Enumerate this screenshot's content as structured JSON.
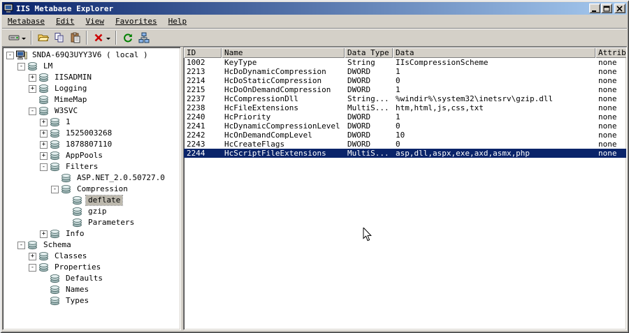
{
  "window": {
    "title": "IIS Metabase Explorer",
    "controls": [
      "minimize",
      "maximize",
      "close"
    ]
  },
  "menu": {
    "items": [
      "Metabase",
      "Edit",
      "View",
      "Favorites",
      "Help"
    ]
  },
  "toolbar": {
    "buttons": [
      {
        "name": "connect-button",
        "icon": "drive-connect-icon",
        "dropdown": true,
        "sep_before": false
      },
      {
        "name": "open-button",
        "icon": "folder-open-icon",
        "dropdown": false,
        "sep_before": true
      },
      {
        "name": "copy-button",
        "icon": "copy-icon",
        "dropdown": false,
        "sep_before": false
      },
      {
        "name": "paste-button",
        "icon": "paste-icon",
        "dropdown": false,
        "sep_before": false
      },
      {
        "name": "delete-button",
        "icon": "delete-x-icon",
        "dropdown": true,
        "sep_before": true
      },
      {
        "name": "refresh-button",
        "icon": "refresh-icon",
        "dropdown": false,
        "sep_before": true
      },
      {
        "name": "network-button",
        "icon": "network-nodes-icon",
        "dropdown": false,
        "sep_before": false
      }
    ]
  },
  "tree": {
    "items": [
      {
        "level": 0,
        "label": "SNDA-69Q3UYY3V6 ( local )",
        "expand": "-",
        "icon": "computer",
        "selected": false
      },
      {
        "level": 1,
        "label": "LM",
        "expand": "-",
        "icon": "key",
        "selected": false
      },
      {
        "level": 2,
        "label": "IISADMIN",
        "expand": "+",
        "icon": "key",
        "selected": false
      },
      {
        "level": 2,
        "label": "Logging",
        "expand": "+",
        "icon": "key",
        "selected": false
      },
      {
        "level": 2,
        "label": "MimeMap",
        "expand": "",
        "icon": "key",
        "selected": false
      },
      {
        "level": 2,
        "label": "W3SVC",
        "expand": "-",
        "icon": "key",
        "selected": false
      },
      {
        "level": 3,
        "label": "1",
        "expand": "+",
        "icon": "key",
        "selected": false
      },
      {
        "level": 3,
        "label": "1525003268",
        "expand": "+",
        "icon": "key",
        "selected": false
      },
      {
        "level": 3,
        "label": "1878807110",
        "expand": "+",
        "icon": "key",
        "selected": false
      },
      {
        "level": 3,
        "label": "AppPools",
        "expand": "+",
        "icon": "key",
        "selected": false
      },
      {
        "level": 3,
        "label": "Filters",
        "expand": "-",
        "icon": "key",
        "selected": false
      },
      {
        "level": 4,
        "label": "ASP.NET_2.0.50727.0",
        "expand": "",
        "icon": "key",
        "selected": false
      },
      {
        "level": 4,
        "label": "Compression",
        "expand": "-",
        "icon": "key",
        "selected": false
      },
      {
        "level": 5,
        "label": "deflate",
        "expand": "",
        "icon": "key",
        "selected": true
      },
      {
        "level": 5,
        "label": "gzip",
        "expand": "",
        "icon": "key",
        "selected": false
      },
      {
        "level": 5,
        "label": "Parameters",
        "expand": "",
        "icon": "key",
        "selected": false
      },
      {
        "level": 3,
        "label": "Info",
        "expand": "+",
        "icon": "key",
        "selected": false
      },
      {
        "level": 1,
        "label": "Schema",
        "expand": "-",
        "icon": "key",
        "selected": false
      },
      {
        "level": 2,
        "label": "Classes",
        "expand": "+",
        "icon": "key",
        "selected": false
      },
      {
        "level": 2,
        "label": "Properties",
        "expand": "-",
        "icon": "key",
        "selected": false
      },
      {
        "level": 3,
        "label": "Defaults",
        "expand": "",
        "icon": "key",
        "selected": false
      },
      {
        "level": 3,
        "label": "Names",
        "expand": "",
        "icon": "key",
        "selected": false
      },
      {
        "level": 3,
        "label": "Types",
        "expand": "",
        "icon": "key",
        "selected": false
      }
    ]
  },
  "list": {
    "columns": [
      "ID",
      "Name",
      "Data Type",
      "Data",
      "Attributes"
    ],
    "rows": [
      [
        "1002",
        "KeyType",
        "String",
        "IIsCompressionScheme",
        "none"
      ],
      [
        "2213",
        "HcDoDynamicCompression",
        "DWORD",
        "1",
        "none"
      ],
      [
        "2214",
        "HcDoStaticCompression",
        "DWORD",
        "0",
        "none"
      ],
      [
        "2215",
        "HcDoOnDemandCompression",
        "DWORD",
        "1",
        "none"
      ],
      [
        "2237",
        "HcCompressionDll",
        "String...",
        "%windir%\\system32\\inetsrv\\gzip.dll",
        "none"
      ],
      [
        "2238",
        "HcFileExtensions",
        "MultiS...",
        "htm,html,js,css,txt",
        "none"
      ],
      [
        "2240",
        "HcPriority",
        "DWORD",
        "1",
        "none"
      ],
      [
        "2241",
        "HcDynamicCompressionLevel",
        "DWORD",
        "0",
        "none"
      ],
      [
        "2242",
        "HcOnDemandCompLevel",
        "DWORD",
        "10",
        "none"
      ],
      [
        "2243",
        "HcCreateFlags",
        "DWORD",
        "0",
        "none"
      ],
      [
        "2244",
        "HcScriptFileExtensions",
        "MultiS...",
        "asp,dll,aspx,exe,axd,asmx,php",
        "none"
      ]
    ],
    "selected_row_index": 10
  },
  "colors": {
    "titlebar-left": "#0a246a",
    "titlebar-right": "#a6caf0",
    "chrome": "#d4d0c8",
    "selection-bg": "#0a246a",
    "selection-text": "#ffffff",
    "tree-inactive-selection": "#bdb9ae"
  }
}
